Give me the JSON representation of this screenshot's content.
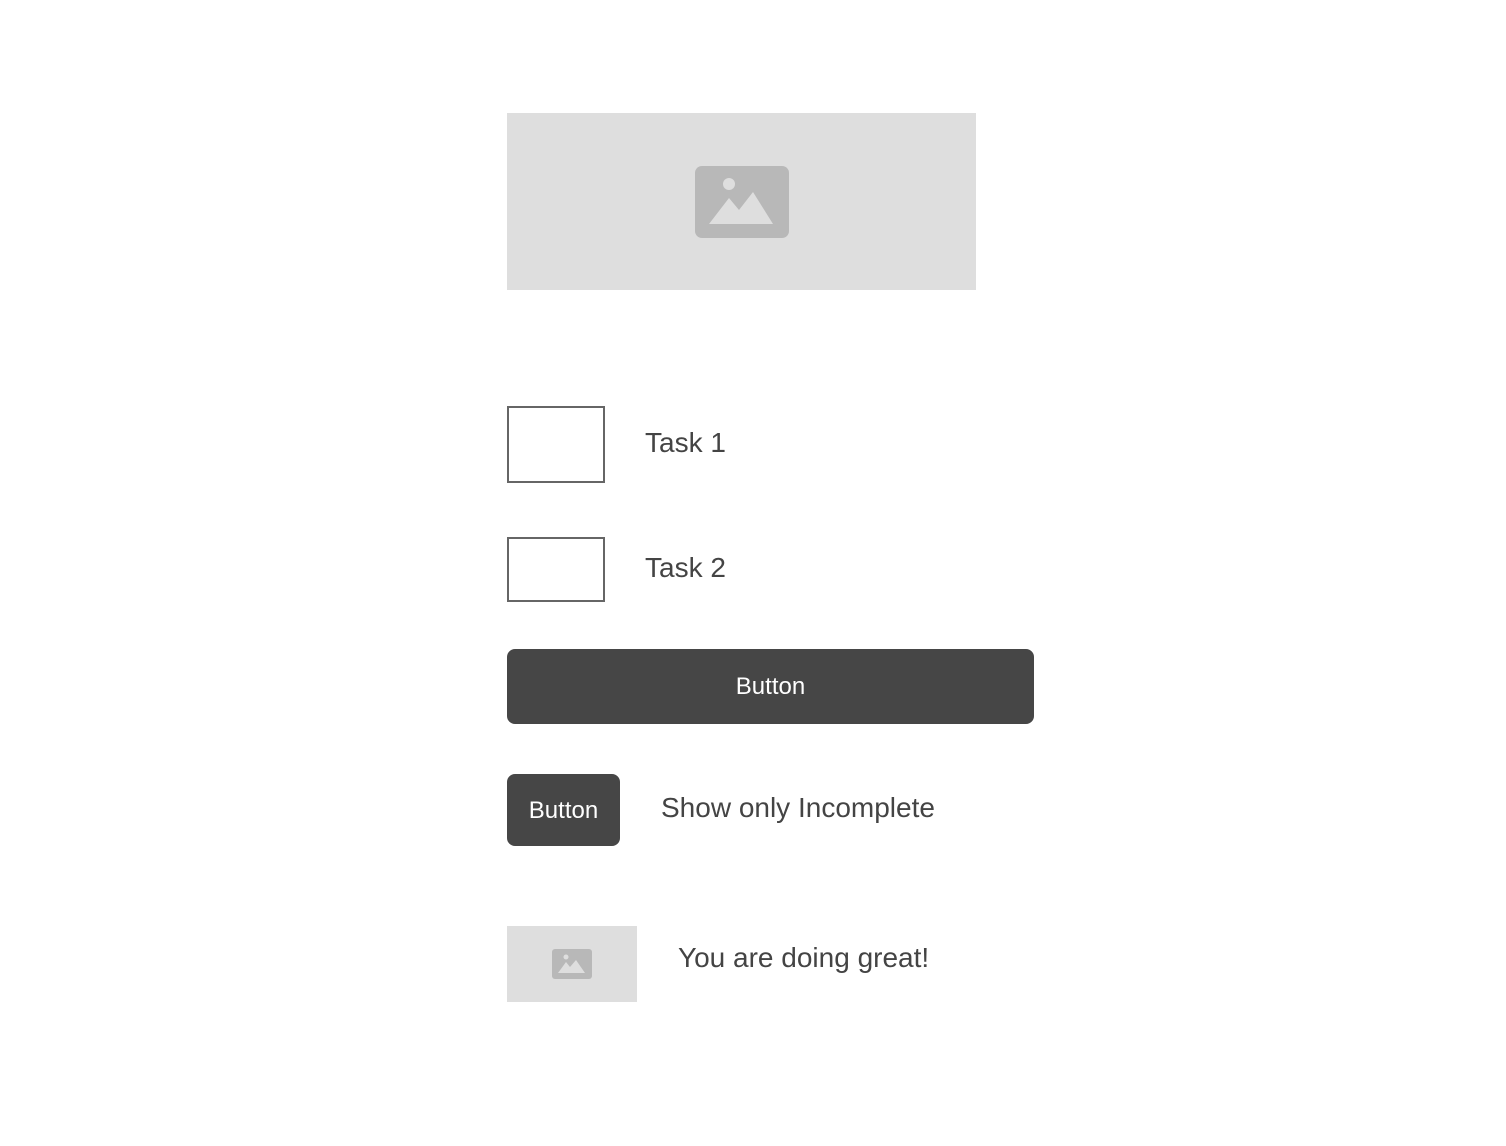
{
  "hero_image": {
    "icon": "image-icon"
  },
  "tasks": [
    {
      "label": "Task 1",
      "checked": false
    },
    {
      "label": "Task 2",
      "checked": false
    }
  ],
  "primary_button": {
    "label": "Button"
  },
  "filter": {
    "button_label": "Button",
    "label": "Show only Incomplete"
  },
  "feedback": {
    "icon": "image-icon",
    "message": "You are doing great!"
  },
  "colors": {
    "placeholder_bg": "#dedede",
    "placeholder_icon": "#b8b8b8",
    "button_bg": "#464646",
    "text": "#444444"
  }
}
